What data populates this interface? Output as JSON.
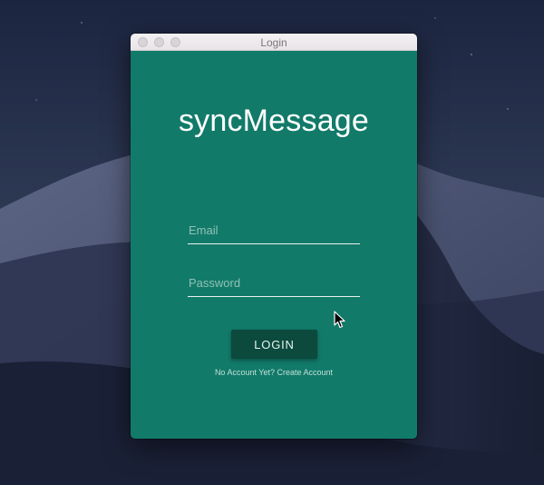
{
  "window": {
    "title": "Login",
    "background_color": "#127a69"
  },
  "app": {
    "title": "syncMessage"
  },
  "form": {
    "email": {
      "value": "",
      "placeholder": "Email"
    },
    "password": {
      "value": "",
      "placeholder": "Password"
    },
    "login_label": "LOGIN",
    "login_button_color": "#0b4a3d"
  },
  "footer": {
    "prompt": "No Account Yet?",
    "link": "Create Account"
  },
  "icons": {
    "cursor": "arrow-cursor-icon"
  }
}
